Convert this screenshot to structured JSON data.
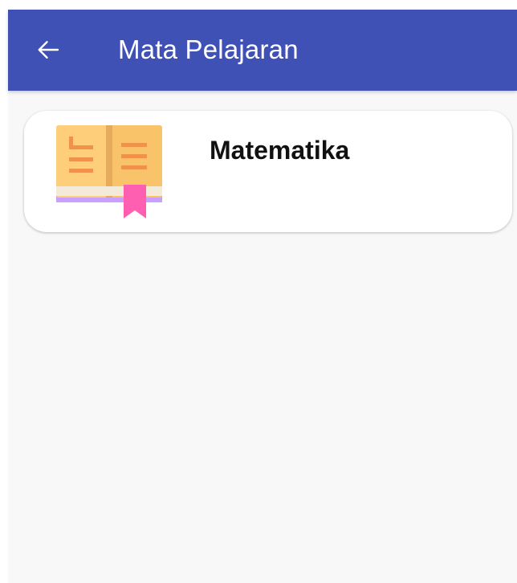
{
  "app_bar": {
    "title": "Mata Pelajaran",
    "back_icon": "arrow-back-icon",
    "background_color": "#3f51b5"
  },
  "subjects": [
    {
      "name": "Matematika",
      "icon": "open-book-icon"
    }
  ]
}
